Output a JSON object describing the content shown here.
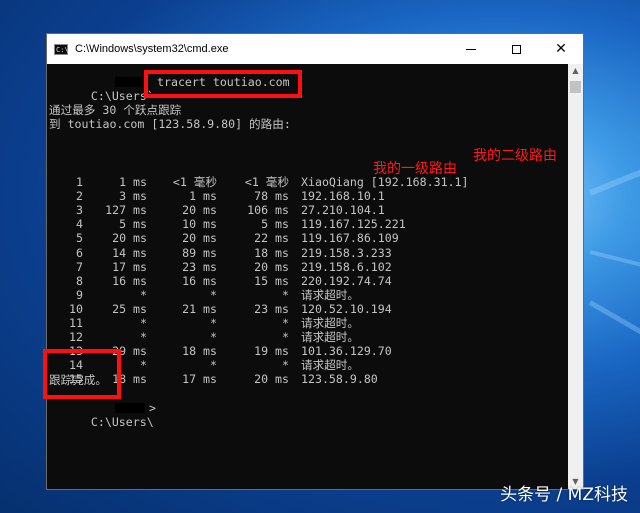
{
  "window": {
    "title": "C:\\Windows\\system32\\cmd.exe",
    "icon_label": "C:\\"
  },
  "console": {
    "prompt1_prefix": "C:\\Users`",
    "command": "tracert toutiao.com",
    "header1": "通过最多 30 个跃点跟踪",
    "header2": "到 toutiao.com [123.58.9.80] 的路由:",
    "hops": [
      {
        "n": "1",
        "t1": "1 ms",
        "t2": "<1 毫秒",
        "t3": "<1 毫秒",
        "host": "XiaoQiang [192.168.31.1]"
      },
      {
        "n": "2",
        "t1": "3 ms",
        "t2": "1 ms",
        "t3": "78 ms",
        "host": "192.168.10.1"
      },
      {
        "n": "3",
        "t1": "127 ms",
        "t2": "20 ms",
        "t3": "106 ms",
        "host": "27.210.104.1"
      },
      {
        "n": "4",
        "t1": "5 ms",
        "t2": "10 ms",
        "t3": "5 ms",
        "host": "119.167.125.221"
      },
      {
        "n": "5",
        "t1": "20 ms",
        "t2": "20 ms",
        "t3": "22 ms",
        "host": "119.167.86.109"
      },
      {
        "n": "6",
        "t1": "14 ms",
        "t2": "89 ms",
        "t3": "18 ms",
        "host": "219.158.3.233"
      },
      {
        "n": "7",
        "t1": "17 ms",
        "t2": "23 ms",
        "t3": "20 ms",
        "host": "219.158.6.102"
      },
      {
        "n": "8",
        "t1": "16 ms",
        "t2": "16 ms",
        "t3": "15 ms",
        "host": "220.192.74.74"
      },
      {
        "n": "9",
        "t1": "*",
        "t2": "*",
        "t3": "*",
        "host": "请求超时。"
      },
      {
        "n": "10",
        "t1": "25 ms",
        "t2": "21 ms",
        "t3": "23 ms",
        "host": "120.52.10.194"
      },
      {
        "n": "11",
        "t1": "*",
        "t2": "*",
        "t3": "*",
        "host": "请求超时。"
      },
      {
        "n": "12",
        "t1": "*",
        "t2": "*",
        "t3": "*",
        "host": "请求超时。"
      },
      {
        "n": "13",
        "t1": "29 ms",
        "t2": "18 ms",
        "t3": "19 ms",
        "host": "101.36.129.70"
      },
      {
        "n": "14",
        "t1": "*",
        "t2": "*",
        "t3": "*",
        "host": "请求超时。"
      },
      {
        "n": "15",
        "t1": "18 ms",
        "t2": "17 ms",
        "t3": "20 ms",
        "host": "123.58.9.80"
      }
    ],
    "done": "跟踪完成。",
    "prompt2_prefix": "C:\\Users\\",
    "prompt2_suffix": ">"
  },
  "annotations": {
    "second_router": "我的二级路由",
    "first_router": "我的一级路由"
  },
  "watermark": "头条号 / MZ科技",
  "colors": {
    "highlight": "#ff1010",
    "console_bg": "#0c0c0c",
    "console_text": "#c4c4c4"
  }
}
